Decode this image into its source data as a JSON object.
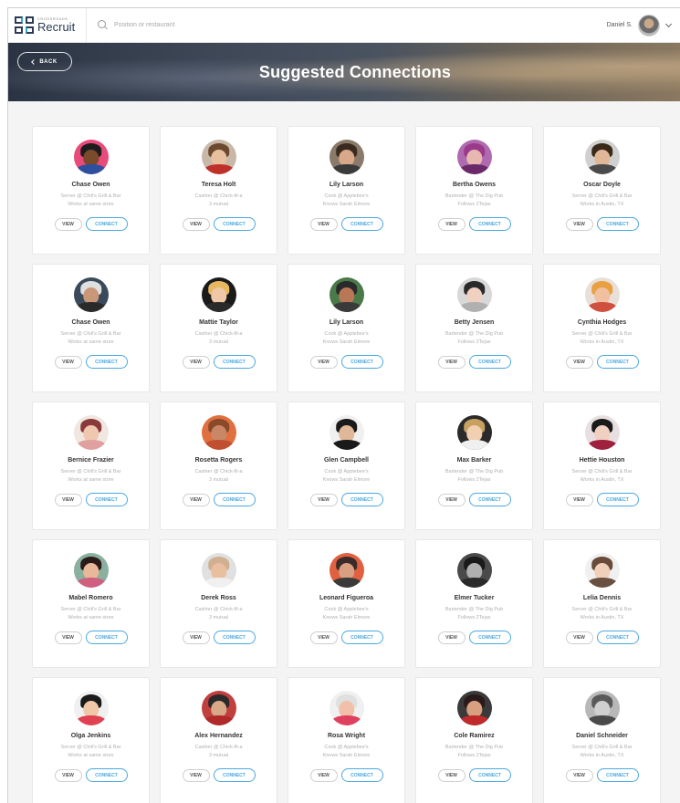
{
  "app": {
    "logo_small": "CROSSROADS",
    "logo_name": "Recruit",
    "search_placeholder": "Position or restaurant",
    "user_name": "Daniel S."
  },
  "hero": {
    "back_label": "BACK",
    "title": "Suggested Connections"
  },
  "buttons": {
    "view": "VIEW",
    "connect": "CONNECT"
  },
  "cards": [
    {
      "name": "Chase Owen",
      "line1": "Server @ Chili's Grill & Bar",
      "line2": "Works at same store",
      "skin": "#7a4a2a",
      "hair": "#1c1c1c",
      "bg": "#e84a7a",
      "body": "#2c4fa0"
    },
    {
      "name": "Teresa Holt",
      "line1": "Cashier @ Chick-fil-a",
      "line2": "3 mutual",
      "skin": "#e8c0a0",
      "hair": "#6b4a30",
      "bg": "#c8b8a8",
      "body": "#c0302a"
    },
    {
      "name": "Lily Larson",
      "line1": "Cook @ Applebee's",
      "line2": "Knows Sarah Elmore",
      "skin": "#d8a888",
      "hair": "#3a2a20",
      "bg": "#8a7a6a",
      "body": "#3a3a3a"
    },
    {
      "name": "Bertha Owens",
      "line1": "Bartender @ The Dig Pub",
      "line2": "Follows 2Tejas",
      "skin": "#e8b8b0",
      "hair": "#9a3a8a",
      "bg": "#b06ab0",
      "body": "#6a2a6a"
    },
    {
      "name": "Oscar Doyle",
      "line1": "Server @ Chili's Grill & Bar",
      "line2": "Works in Austin, TX",
      "skin": "#e0b898",
      "hair": "#3a2a1a",
      "bg": "#d0d0d0",
      "body": "#4a4a4a"
    },
    {
      "name": "Chase Owen",
      "line1": "Server @ Chili's Grill & Bar",
      "line2": "Works at same store",
      "skin": "#c89878",
      "hair": "#e0e0e0",
      "bg": "#3a4a5a",
      "body": "#2a2a2a"
    },
    {
      "name": "Mattie Taylor",
      "line1": "Cashier @ Chick-fil-a",
      "line2": "3 mutual",
      "skin": "#f0c8a8",
      "hair": "#e8b860",
      "bg": "#1a1a1a",
      "body": "#2a2a2a"
    },
    {
      "name": "Lily Larson",
      "line1": "Cook @ Applebee's",
      "line2": "Knows Sarah Elmore",
      "skin": "#b87858",
      "hair": "#2a2a2a",
      "bg": "#4a7a4a",
      "body": "#3a3a3a"
    },
    {
      "name": "Betty Jensen",
      "line1": "Bartender @ The Dig Pub",
      "line2": "Follows 2Tejas",
      "skin": "#f0d0c0",
      "hair": "#2a2a2a",
      "bg": "#d8d8d8",
      "body": "#b0b0b0"
    },
    {
      "name": "Cynthia Hodges",
      "line1": "Server @ Chili's Grill & Bar",
      "line2": "Works in Austin, TX",
      "skin": "#f0c0a0",
      "hair": "#e8a040",
      "bg": "#e8e0d8",
      "body": "#d05040"
    },
    {
      "name": "Bernice Frazier",
      "line1": "Server @ Chili's Grill & Bar",
      "line2": "Works at same store",
      "skin": "#f0c8b0",
      "hair": "#8a3a3a",
      "bg": "#f0e8e0",
      "body": "#e0a0a0"
    },
    {
      "name": "Rosetta Rogers",
      "line1": "Cashier @ Chick-fil-a",
      "line2": "3 mutual",
      "skin": "#c88868",
      "hair": "#8a4a2a",
      "bg": "#e07040",
      "body": "#c05030"
    },
    {
      "name": "Glen Campbell",
      "line1": "Cook @ Applebee's",
      "line2": "Knows Sarah Elmore",
      "skin": "#e0b898",
      "hair": "#1a1a1a",
      "bg": "#f0f0f0",
      "body": "#1a1a1a"
    },
    {
      "name": "Max Barker",
      "line1": "Bartender @ The Dig Pub",
      "line2": "Follows 2Tejas",
      "skin": "#f0d0b0",
      "hair": "#c8a060",
      "bg": "#2a2a2a",
      "body": "#f0f0f0"
    },
    {
      "name": "Hettie Houston",
      "line1": "Server @ Chili's Grill & Bar",
      "line2": "Works in Austin, TX",
      "skin": "#f0d0c0",
      "hair": "#1a1a1a",
      "bg": "#e8e0e0",
      "body": "#a02040"
    },
    {
      "name": "Mabel Romero",
      "line1": "Server @ Chili's Grill & Bar",
      "line2": "Works at same store",
      "skin": "#e8b898",
      "hair": "#2a1a1a",
      "bg": "#8ab0a0",
      "body": "#d06080"
    },
    {
      "name": "Derek Ross",
      "line1": "Cashier @ Chick-fil-a",
      "line2": "3 mutual",
      "skin": "#e8c0a0",
      "hair": "#d0b090",
      "bg": "#e0e0e0",
      "body": "#f0f0f0"
    },
    {
      "name": "Leonard Figueroa",
      "line1": "Cook @ Applebee's",
      "line2": "Knows Sarah Elmore",
      "skin": "#d8a080",
      "hair": "#3a2a2a",
      "bg": "#e06040",
      "body": "#3a3a3a"
    },
    {
      "name": "Elmer Tucker",
      "line1": "Bartender @ The Dig Pub",
      "line2": "Follows 2Tejas",
      "skin": "#b0b0b0",
      "hair": "#1a1a1a",
      "bg": "#4a4a4a",
      "body": "#2a2a2a"
    },
    {
      "name": "Lelia Dennis",
      "line1": "Server @ Chili's Grill & Bar",
      "line2": "Works in Austin, TX",
      "skin": "#f0d0b8",
      "hair": "#6a4a3a",
      "bg": "#f0f0f0",
      "body": "#6a5040"
    },
    {
      "name": "Olga Jenkins",
      "line1": "Server @ Chili's Grill & Bar",
      "line2": "Works at same store",
      "skin": "#f0c8a8",
      "hair": "#1a1a1a",
      "bg": "#f0f0f0",
      "body": "#e04050"
    },
    {
      "name": "Alex Hernandez",
      "line1": "Cashier @ Chick-fil-a",
      "line2": "3 mutual",
      "skin": "#d8a888",
      "hair": "#2a2a2a",
      "bg": "#c04040",
      "body": "#b02a2a"
    },
    {
      "name": "Rosa Wright",
      "line1": "Cook @ Applebee's",
      "line2": "Knows Sarah Elmore",
      "skin": "#f0c0a8",
      "hair": "#e0e0e0",
      "bg": "#f0f0f0",
      "body": "#e04060"
    },
    {
      "name": "Cole Ramirez",
      "line1": "Bartender @ The Dig Pub",
      "line2": "Follows 2Tejas",
      "skin": "#d8a080",
      "hair": "#2a1a1a",
      "bg": "#3a3a3a",
      "body": "#c02a2a"
    },
    {
      "name": "Daniel Schneider",
      "line1": "Server @ Chili's Grill & Bar",
      "line2": "Works in Austin, TX",
      "skin": "#d0d0d0",
      "hair": "#5a5a5a",
      "bg": "#b8b8b8",
      "body": "#4a4a4a"
    }
  ]
}
